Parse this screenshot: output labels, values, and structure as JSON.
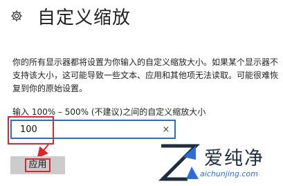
{
  "header": {
    "icon": "gear-icon",
    "title": "自定义缩放"
  },
  "description": "你的所有显示器都将设置为你输入的自定义缩放大小。如果某个显示器不支持该大小，这可能导致一些文本、应用和其他项无法读取。可能很难恢复到你的原始设置。",
  "field": {
    "label": "输入 100% – 500% (不建议)之间的自定义缩放大小",
    "value": "100",
    "clear_icon": "×"
  },
  "apply_button": {
    "label": "应用"
  },
  "watermark": {
    "brand": "爱纯净",
    "url": "aichunjing.com"
  },
  "colors": {
    "accent": "#1a73d9",
    "highlight": "#d9262f",
    "button_bg": "#cccccc"
  }
}
